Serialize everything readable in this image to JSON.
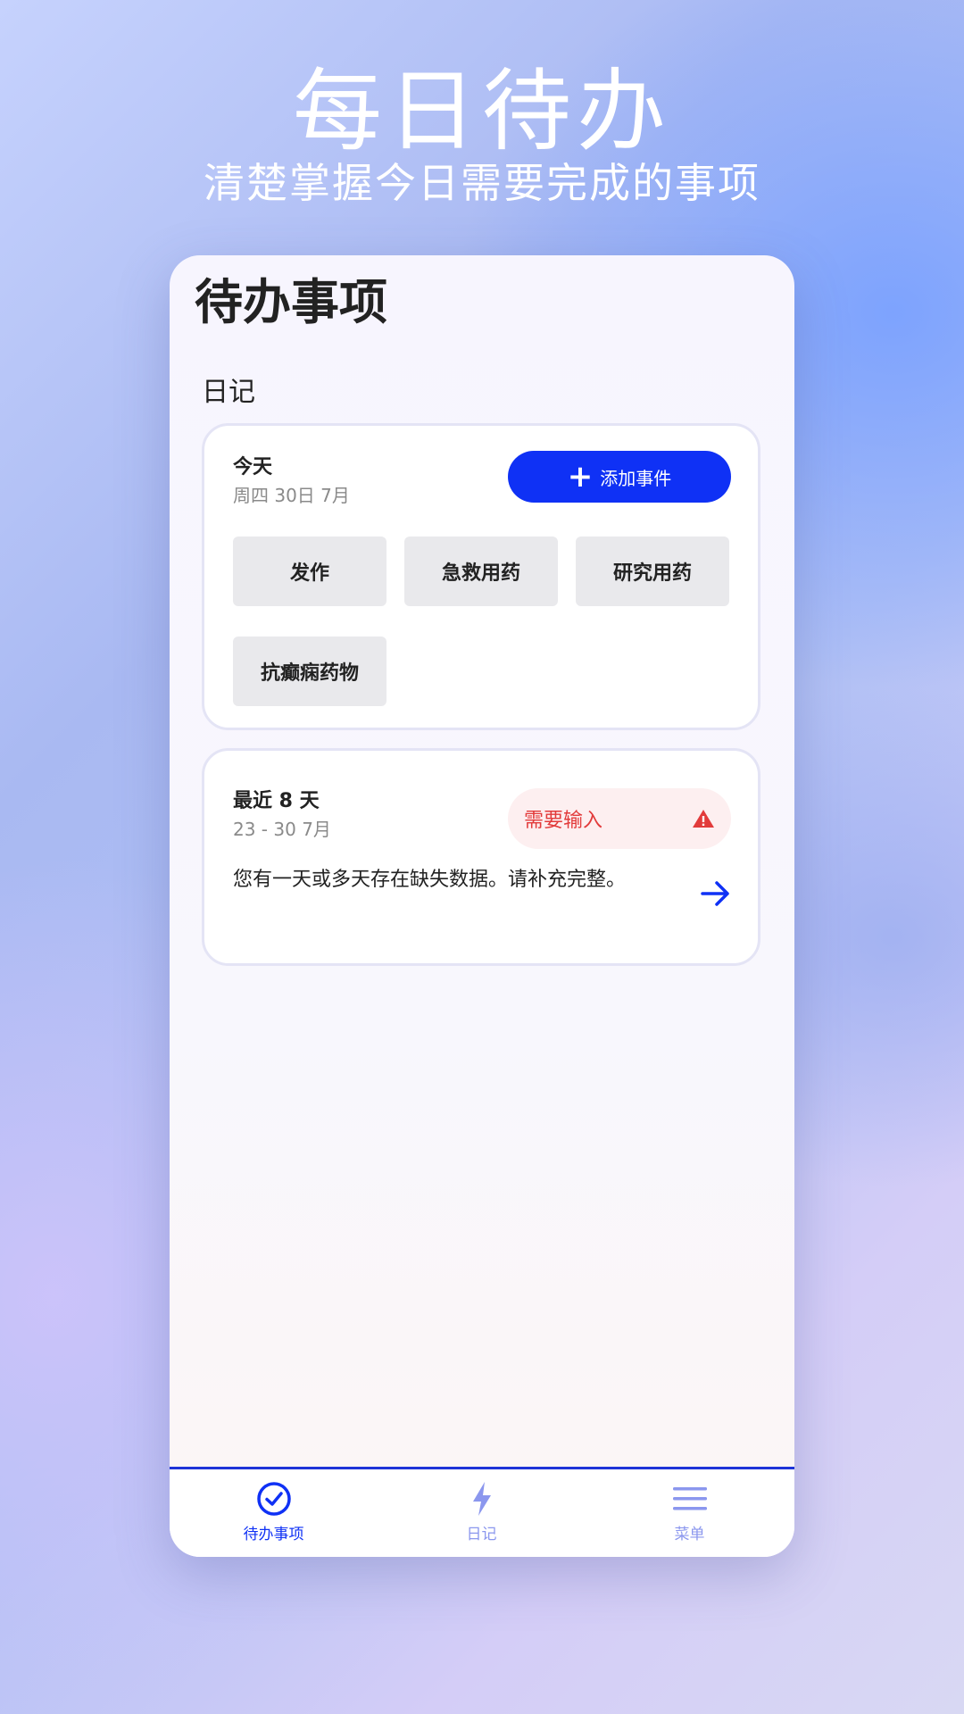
{
  "promo": {
    "headline": "每日待办",
    "subline": "清楚掌握今日需要完成的事项"
  },
  "page": {
    "title": "待办事项",
    "section_label": "日记"
  },
  "today_card": {
    "heading": "今天",
    "date": "周四 30日 7月",
    "add_button_label": "添加事件",
    "chips": [
      "发作",
      "急救用药",
      "研究用药",
      "抗癫痫药物"
    ]
  },
  "recent_card": {
    "heading": "最近 8 天",
    "range": "23 - 30 7月",
    "badge_label": "需要输入",
    "message": "您有一天或多天存在缺失数据。请补充完整。"
  },
  "tabbar": {
    "tabs": [
      {
        "label": "待办事项",
        "icon": "check-circle-icon",
        "active": true
      },
      {
        "label": "日记",
        "icon": "lightning-icon",
        "active": false
      },
      {
        "label": "菜单",
        "icon": "menu-icon",
        "active": false
      }
    ]
  },
  "colors": {
    "accent": "#0f31f5",
    "warning": "#e23b3b",
    "warning_bg": "#fdeff0",
    "inactive_tab": "#8b97ee"
  }
}
